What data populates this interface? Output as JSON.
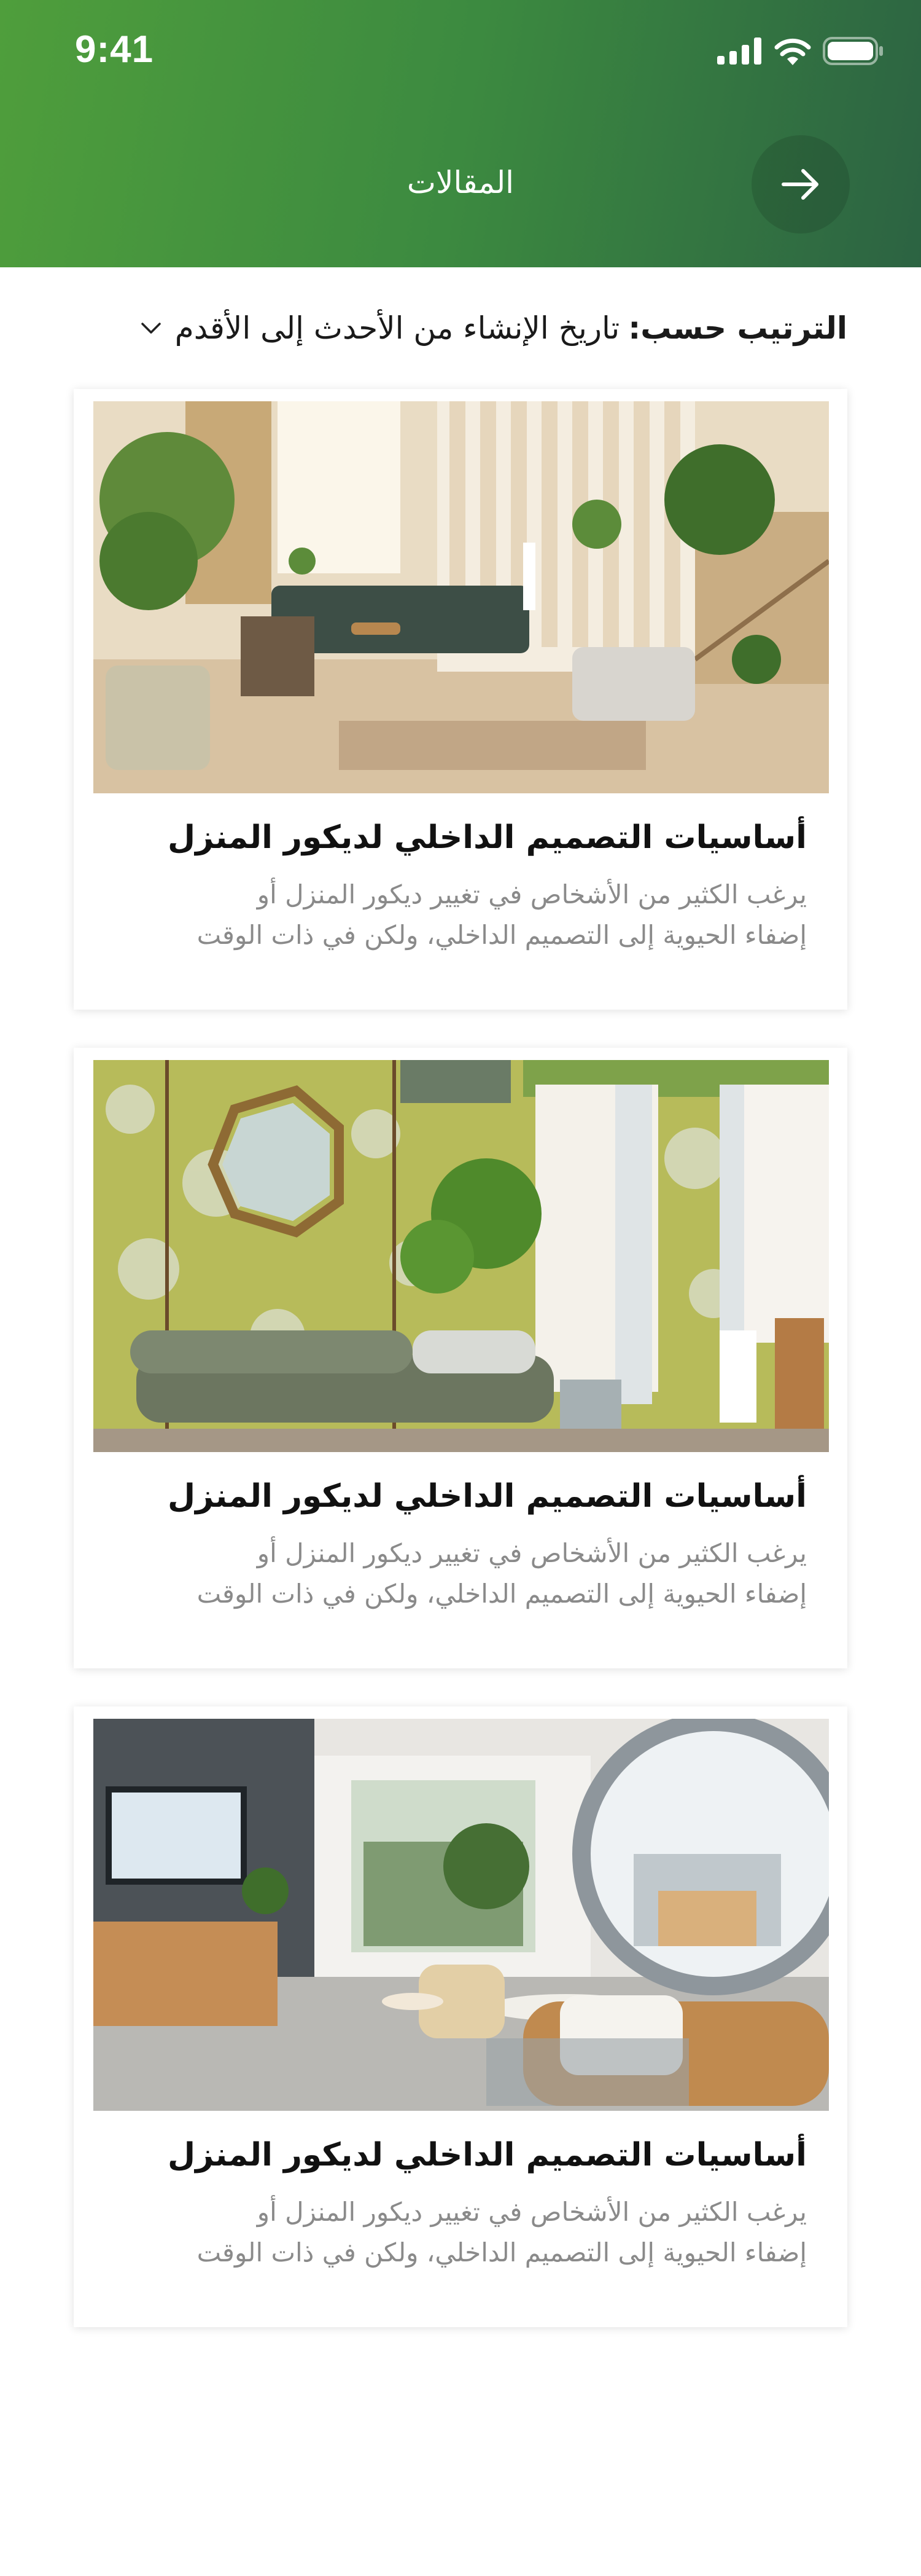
{
  "status_bar": {
    "time": "9:41"
  },
  "header": {
    "title": "المقالات",
    "back_icon": "arrow-right-icon"
  },
  "sort": {
    "label": "الترتيب حسب:",
    "value": "تاريخ الإنشاء من الأحدث إلى الأقدم",
    "icon": "chevron-down-icon"
  },
  "articles": [
    {
      "title": "أساسيات التصميم الداخلي لديكور المنزل",
      "description_line1": "يرغب الكثير من الأشخاص في تغيير ديكور المنزل أو",
      "description_line2": "إضفاء الحيوية إلى التصميم الداخلي، ولكن في ذات الوقت"
    },
    {
      "title": "أساسيات التصميم الداخلي لديكور المنزل",
      "description_line1": "يرغب الكثير من الأشخاص في تغيير ديكور المنزل أو",
      "description_line2": "إضفاء الحيوية إلى التصميم الداخلي، ولكن في ذات الوقت"
    },
    {
      "title": "أساسيات التصميم الداخلي لديكور المنزل",
      "description_line1": "يرغب الكثير من الأشخاص في تغيير ديكور المنزل أو",
      "description_line2": "إضفاء الحيوية إلى التصميم الداخلي، ولكن في ذات الوقت"
    }
  ],
  "colors": {
    "header_start": "#4f9e3c",
    "header_end": "#2c6342",
    "title_text": "#111111",
    "description_text": "#8a8a8a"
  }
}
